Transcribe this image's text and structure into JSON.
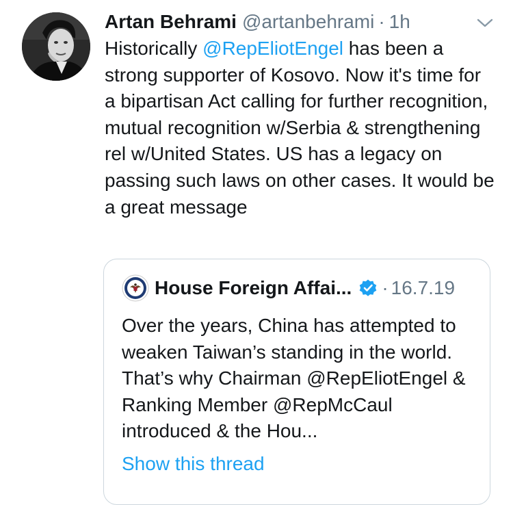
{
  "tweet": {
    "author_name": "Artan Behrami",
    "handle": "@artanbehrami",
    "separator": "·",
    "time": "1h",
    "text_before_mention": "Historically ",
    "mention": "@RepEliotEngel",
    "text_after_mention": " has been a strong supporter of Kosovo. Now it's time for a bipartisan Act calling for further recognition, mutual recognition w/Serbia & strengthening rel w/United States. US has a legacy on passing such laws on other cases. It would be a great message",
    "caret_icon": "chevron-down-icon",
    "avatar_icon": "profile-photo"
  },
  "quoted_tweet": {
    "author_name": "House Foreign Affai...",
    "verified_icon": "verified-badge-icon",
    "separator": "·",
    "date": "16.7.19",
    "text": "Over the years, China has attempted to weaken Taiwan’s standing in the world. That’s why Chairman @RepEliotEngel & Ranking Member @RepMcCaul introduced & the Hou...",
    "show_thread": "Show this thread",
    "avatar_icon": "house-seal-icon"
  },
  "colors": {
    "text": "#14171a",
    "secondary": "#657786",
    "link": "#1da1f2",
    "border": "#ccd6dd"
  }
}
